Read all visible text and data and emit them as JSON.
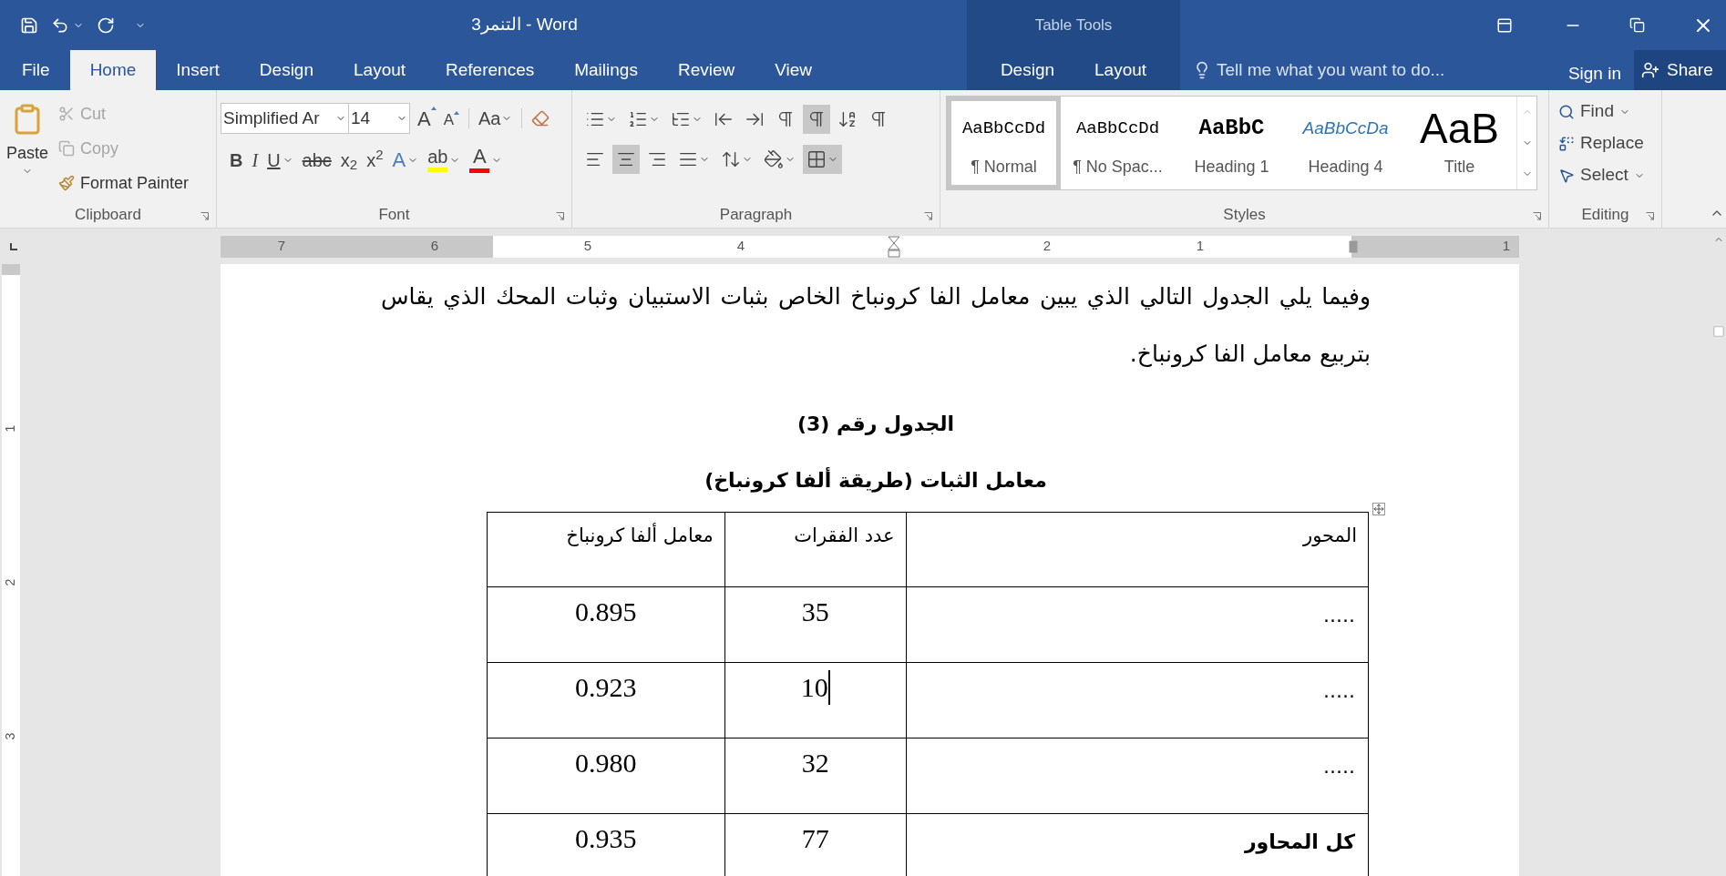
{
  "window": {
    "title": "التنمر3 - Word"
  },
  "tabs": [
    {
      "label": "File",
      "selected": false
    },
    {
      "label": "Home",
      "selected": true
    },
    {
      "label": "Insert",
      "selected": false
    },
    {
      "label": "Design",
      "selected": false
    },
    {
      "label": "Layout",
      "selected": false
    },
    {
      "label": "References",
      "selected": false
    },
    {
      "label": "Mailings",
      "selected": false
    },
    {
      "label": "Review",
      "selected": false
    },
    {
      "label": "View",
      "selected": false
    }
  ],
  "table_tools": {
    "title": "Table Tools",
    "tabs": [
      {
        "label": "Design",
        "selected": false
      },
      {
        "label": "Layout",
        "selected": false
      }
    ]
  },
  "tell_me": {
    "placeholder": "Tell me what you want to do..."
  },
  "account": {
    "sign_in": "Sign in",
    "share": "Share"
  },
  "ribbon": {
    "clipboard": {
      "label": "Clipboard",
      "paste": "Paste",
      "actions": [
        {
          "label": "Cut",
          "kind": "cut",
          "disabled": true
        },
        {
          "label": "Copy",
          "kind": "copy",
          "disabled": true
        },
        {
          "label": "Format Painter",
          "kind": "painter",
          "disabled": false
        }
      ]
    },
    "font": {
      "label": "Font",
      "font_name": "Simplified Ar",
      "font_size": "14",
      "size_buttons": [
        {
          "label": "A",
          "kind": "grow"
        },
        {
          "label": "A",
          "kind": "shrink"
        }
      ],
      "case_button": "Aa",
      "formatting": [
        {
          "label": "B",
          "kind": "bold",
          "dropdown": false
        },
        {
          "label": "I",
          "kind": "italic",
          "dropdown": false
        },
        {
          "label": "U",
          "kind": "underline",
          "dropdown": true
        },
        {
          "label": "abc",
          "kind": "strike",
          "dropdown": false
        },
        {
          "label": "x$_{2}$",
          "kind": "script",
          "dropdown": false
        },
        {
          "label": "x$^{2}$",
          "kind": "script",
          "dropdown": false
        },
        {
          "label": "A",
          "kind": "effects",
          "dropdown": true
        },
        {
          "label": "ab",
          "kind": "highlight",
          "dropdown": true,
          "color": "#ffff00"
        },
        {
          "label": "A",
          "kind": "font_color",
          "dropdown": true,
          "color": "#ff0000"
        }
      ]
    },
    "paragraph": {
      "label": "Paragraph",
      "rows": [
        [
          {
            "kind": "bullets",
            "selected": false,
            "dropdown": true
          },
          {
            "kind": "numbering",
            "selected": false,
            "dropdown": true
          },
          {
            "kind": "multilevel",
            "selected": false,
            "dropdown": true
          },
          {
            "kind": "decrease_indent",
            "selected": false,
            "dropdown": false
          },
          {
            "kind": "increase_indent",
            "selected": false,
            "dropdown": false
          },
          {
            "kind": "ltr",
            "selected": false,
            "dropdown": false
          },
          {
            "kind": "rtl",
            "selected": true,
            "dropdown": false
          },
          {
            "kind": "sort",
            "selected": false,
            "dropdown": false
          },
          {
            "kind": "marks",
            "selected": false,
            "dropdown": false
          }
        ],
        [
          {
            "kind": "align_left",
            "selected": false,
            "dropdown": false
          },
          {
            "kind": "center",
            "selected": true,
            "dropdown": false
          },
          {
            "kind": "align_right",
            "selected": false,
            "dropdown": false
          },
          {
            "kind": "justify",
            "selected": false,
            "dropdown": true
          },
          {
            "kind": "line_spacing",
            "selected": false,
            "dropdown": true
          },
          {
            "kind": "shading",
            "selected": false,
            "dropdown": true
          },
          {
            "kind": "borders",
            "selected": true,
            "dropdown": true
          }
        ]
      ]
    },
    "styles": {
      "label": "Styles",
      "items": [
        {
          "preview": "AaBbCcDd",
          "name": "¶ Normal",
          "kind": "normal",
          "selected": true
        },
        {
          "preview": "AaBbCcDd",
          "name": "¶ No Spac...",
          "kind": "normal",
          "selected": false
        },
        {
          "preview": "AaBbC",
          "name": "Heading 1",
          "kind": "heading1",
          "selected": false
        },
        {
          "preview": "AaBbCcDa",
          "name": "Heading 4",
          "kind": "heading4",
          "selected": false
        },
        {
          "preview": "AaB",
          "name": "Title",
          "kind": "title",
          "selected": false
        }
      ]
    },
    "editing": {
      "label": "Editing",
      "items": [
        {
          "label": "Find",
          "kind": "find",
          "dropdown": true
        },
        {
          "label": "Replace",
          "kind": "replace",
          "dropdown": false
        },
        {
          "label": "Select",
          "kind": "select",
          "dropdown": true
        }
      ]
    }
  },
  "ruler": [
    {
      "kind": "number",
      "label": "7"
    },
    {
      "kind": "number",
      "label": "6"
    },
    {
      "kind": "number",
      "label": "5"
    },
    {
      "kind": "number",
      "label": "4"
    },
    {
      "kind": "marker"
    },
    {
      "kind": "number",
      "label": "2"
    },
    {
      "kind": "number",
      "label": "1"
    },
    {
      "kind": "margin"
    },
    {
      "kind": "number",
      "label": "1"
    }
  ],
  "vertical_ruler": [
    "1",
    "2",
    "3"
  ],
  "document": {
    "paragraph": "وفيما يلي الجدول التالي الذي يبين معامل الفا كرونباخ الخاص بثبات الاستبيان وثبات المحك الذي يقاس بتربيع معامل الفا كرونباخ.",
    "headings": [
      "الجدول رقم (3)",
      "معامل الثبات (طريقة ألفا كرونباخ)"
    ],
    "table": {
      "columns": [
        "معامل ألفا كرونباخ",
        "عدد الفقرات",
        "المحور"
      ],
      "rows": [
        {
          "kind": "item",
          "cursor": false,
          "cells": [
            "0.895",
            "35",
            "....."
          ]
        },
        {
          "kind": "item",
          "cursor": true,
          "cells": [
            "0.923",
            "10",
            "....."
          ]
        },
        {
          "kind": "item",
          "cursor": false,
          "cells": [
            "0.980",
            "32",
            "....."
          ]
        },
        {
          "kind": "total",
          "cursor": false,
          "cells": [
            "0.935",
            "77",
            "كل المحاور"
          ]
        }
      ]
    }
  }
}
